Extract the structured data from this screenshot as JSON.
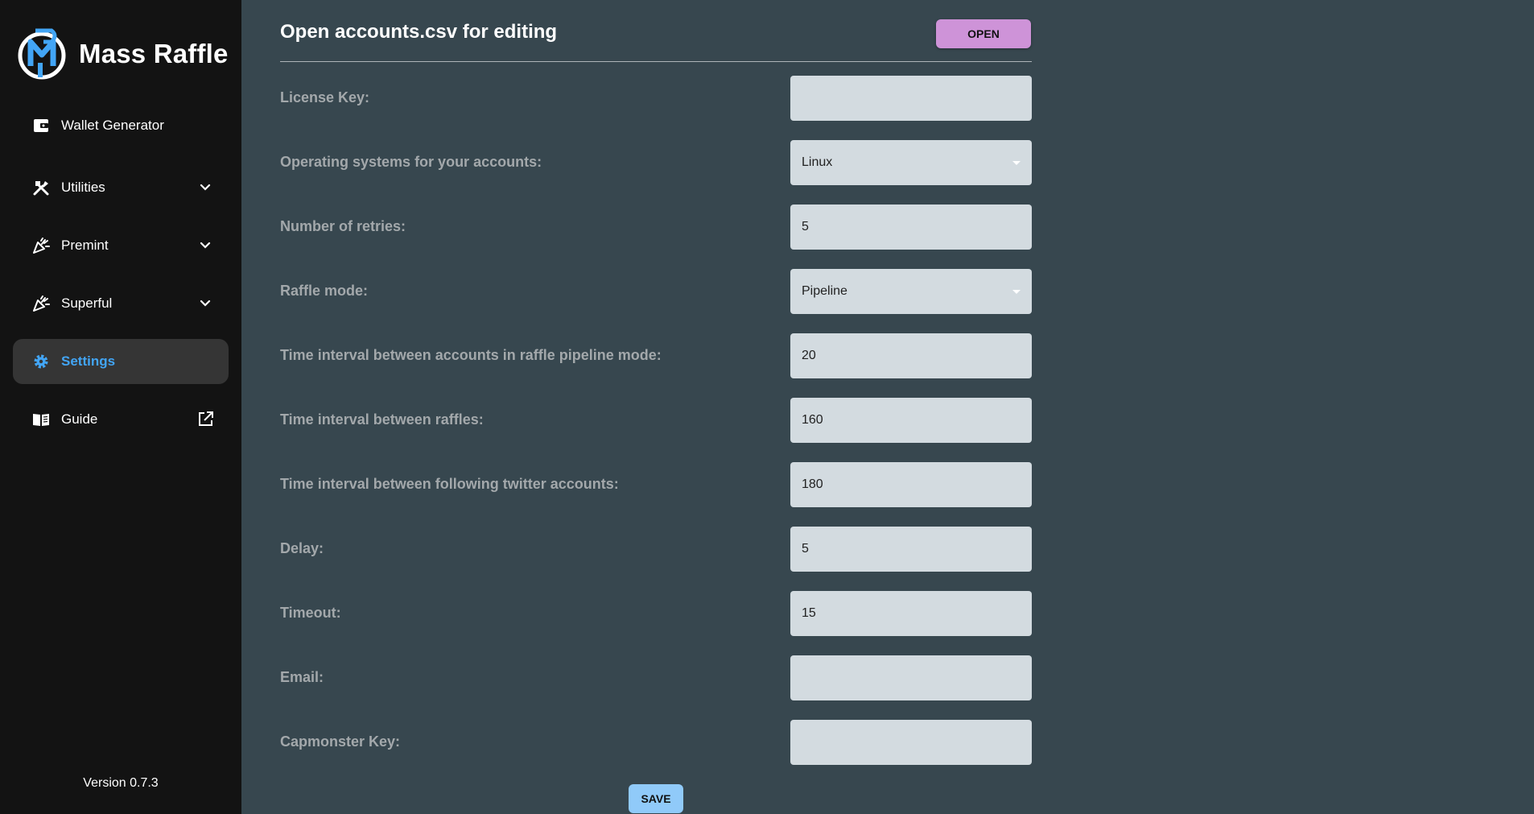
{
  "app": {
    "title": "Mass Raffle",
    "version": "Version 0.7.3",
    "accent": "#42a5f5"
  },
  "sidebar": {
    "items": [
      {
        "label": "Wallet Generator",
        "icon": "wallet-icon"
      },
      {
        "label": "Utilities",
        "icon": "tools-icon"
      },
      {
        "label": "Premint",
        "icon": "party-popper-icon"
      },
      {
        "label": "Superful",
        "icon": "party-popper-icon"
      },
      {
        "label": "Settings",
        "icon": "gear-icon",
        "active": true
      },
      {
        "label": "Guide",
        "icon": "book-icon"
      }
    ]
  },
  "header": {
    "title": "Open accounts.csv for editing",
    "open_label": "OPEN"
  },
  "form": {
    "license_key": {
      "label": "License Key:",
      "value": ""
    },
    "os": {
      "label": "Operating systems for your accounts:",
      "value": "Linux"
    },
    "retries": {
      "label": "Number of retries:",
      "value": "5"
    },
    "raffle_mode": {
      "label": "Raffle mode:",
      "value": "Pipeline"
    },
    "pipeline_interval": {
      "label": "Time interval between accounts in raffle pipeline mode:",
      "value": "20"
    },
    "raffle_interval": {
      "label": "Time interval between raffles:",
      "value": "160"
    },
    "twitter_interval": {
      "label": "Time interval between following twitter accounts:",
      "value": "180"
    },
    "delay": {
      "label": "Delay:",
      "value": "5"
    },
    "timeout": {
      "label": "Timeout:",
      "value": "15"
    },
    "email": {
      "label": "Email:",
      "value": ""
    },
    "capmonster": {
      "label": "Capmonster Key:",
      "value": ""
    }
  },
  "save_label": "SAVE",
  "colors": {
    "open_button": "#ce93d8",
    "save_button": "#90caf9",
    "background": "#37474f",
    "sidebar": "#131313"
  }
}
